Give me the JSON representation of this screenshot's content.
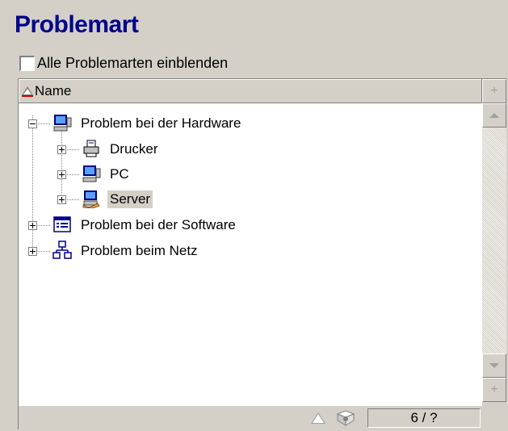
{
  "title": "Problemart",
  "show_all": {
    "label": "Alle Problemarten einblenden",
    "checked": false
  },
  "column_header": {
    "label": "Name",
    "sort_icon": "sort-ascending-icon"
  },
  "tree": [
    {
      "label": "Problem bei der Hardware",
      "icon": "computer-icon",
      "expanded": true,
      "level": 0
    },
    {
      "label": "Drucker",
      "icon": "printer-icon",
      "expanded": false,
      "level": 1
    },
    {
      "label": "PC",
      "icon": "computer-icon",
      "expanded": false,
      "level": 1
    },
    {
      "label": "Server",
      "icon": "server-icon",
      "expanded": false,
      "level": 1,
      "selected": true
    },
    {
      "label": "Problem bei der Software",
      "icon": "software-icon",
      "expanded": false,
      "level": 0
    },
    {
      "label": "Problem beim Netz",
      "icon": "network-icon",
      "expanded": false,
      "level": 0
    }
  ],
  "scrollbar": {
    "add_label": "+"
  },
  "status": {
    "counter": "6 / ?"
  }
}
